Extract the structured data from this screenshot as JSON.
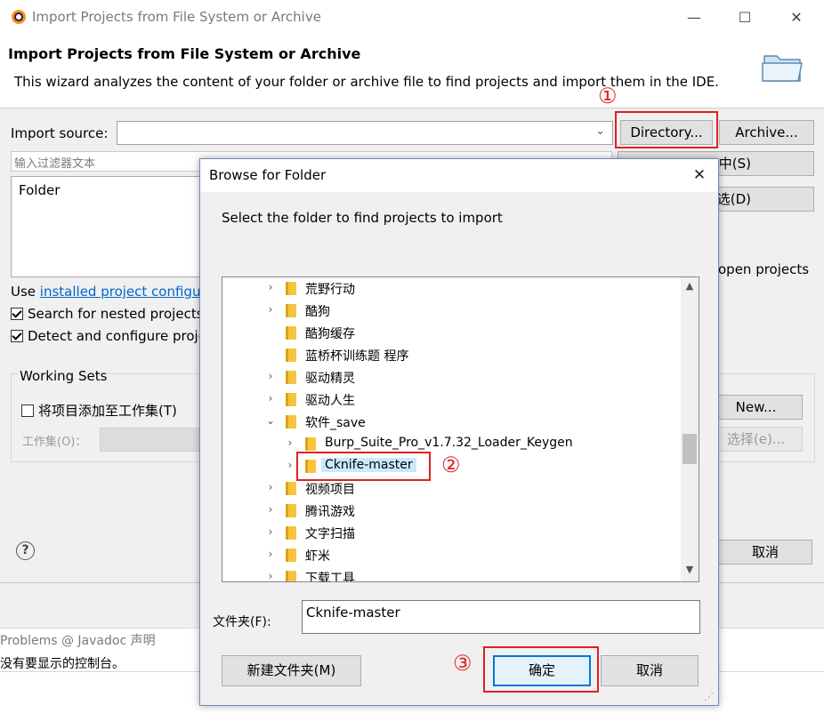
{
  "window": {
    "title": "Import Projects from File System or Archive",
    "controls": {
      "minimize": "—",
      "maximize": "☐",
      "close": "✕"
    }
  },
  "wizard": {
    "heading": "Import Projects from File System or Archive",
    "description": "This wizard analyzes the content of your folder or archive file to find projects and import them in the IDE.",
    "import_source_label": "Import source:",
    "import_source_value": "",
    "directory_button": "Directory...",
    "archive_button": "Archive...",
    "filter_placeholder": "输入过滤器文本",
    "project_list": [
      "Folder"
    ],
    "select_all_button": "中(S)",
    "deselect_all_button": "选(D)",
    "hide_open_label": "open projects",
    "use_prefix": "Use ",
    "use_link": "installed project configu",
    "search_nested_label": "Search for nested projects",
    "search_nested_checked": true,
    "detect_configure_label": "Detect and configure proje",
    "detect_configure_checked": true,
    "working_sets_label": "Working Sets",
    "add_workset_label": "将项目添加至工作集(T)",
    "add_workset_checked": false,
    "workset_label": "工作集(O)：",
    "new_button": "New...",
    "select_ws_button": "选择(e)...",
    "help_icon": "?",
    "cancel_button": "取消"
  },
  "background": {
    "console_tabs": "Problems  @ Javadoc  声明",
    "console_text": "没有要显示的控制台。"
  },
  "browse_dialog": {
    "title": "Browse for Folder",
    "close": "✕",
    "prompt": "Select the folder to find projects to import",
    "tree": [
      {
        "label": "荒野行动",
        "arrow": "›",
        "depth": 0
      },
      {
        "label": "酷狗",
        "arrow": "›",
        "depth": 0
      },
      {
        "label": "酷狗缓存",
        "arrow": "",
        "depth": 0
      },
      {
        "label": "蓝桥杯训练题 程序",
        "arrow": "",
        "depth": 0
      },
      {
        "label": "驱动精灵",
        "arrow": "›",
        "depth": 0
      },
      {
        "label": "驱动人生",
        "arrow": "›",
        "depth": 0
      },
      {
        "label": "软件_save",
        "arrow": "⌄",
        "depth": 0
      },
      {
        "label": "Burp_Suite_Pro_v1.7.32_Loader_Keygen",
        "arrow": "›",
        "depth": 1
      },
      {
        "label": "Cknife-master",
        "arrow": "›",
        "depth": 1,
        "selected": true
      },
      {
        "label": "视频项目",
        "arrow": "›",
        "depth": 0
      },
      {
        "label": "腾讯游戏",
        "arrow": "›",
        "depth": 0
      },
      {
        "label": "文字扫描",
        "arrow": "›",
        "depth": 0
      },
      {
        "label": "虾米",
        "arrow": "›",
        "depth": 0
      },
      {
        "label": "下载工具",
        "arrow": "›",
        "depth": 0
      }
    ],
    "folder_label": "文件夹(F):",
    "folder_value": "Cknife-master",
    "new_folder_button": "新建文件夹(M)",
    "ok_button": "确定",
    "cancel_button": "取消"
  },
  "annotations": {
    "one": "①",
    "two": "②",
    "three": "③",
    "color": "#e02020"
  }
}
